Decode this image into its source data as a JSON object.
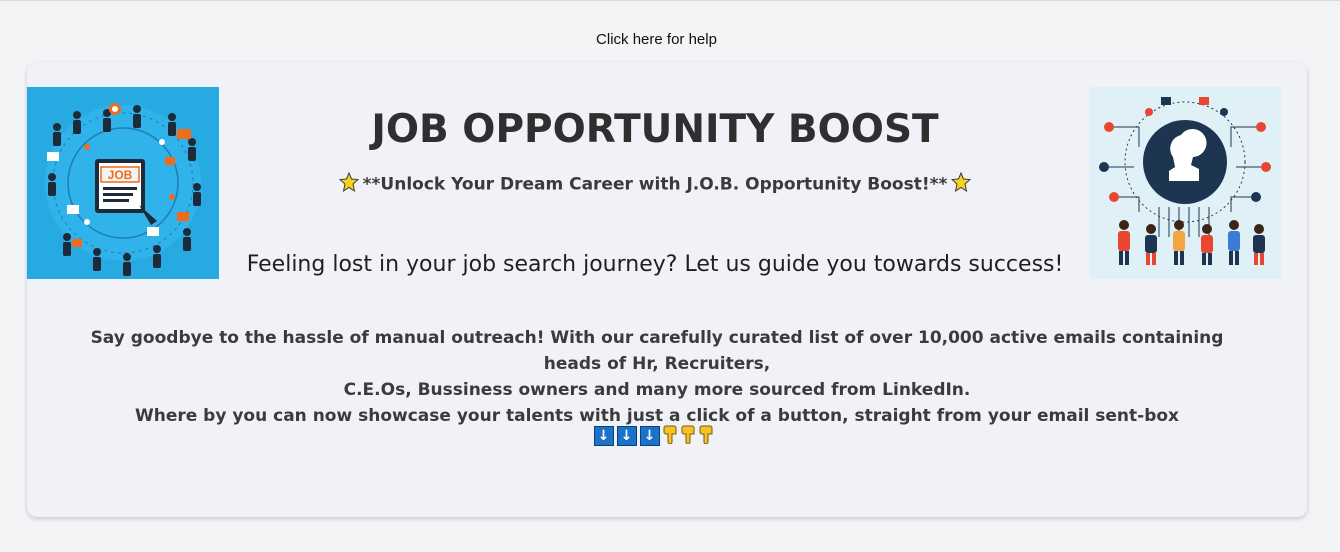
{
  "help_link": "Click here for help",
  "header": {
    "title": "JOB OPPORTUNITY BOOST",
    "subtitle": "**Unlock Your Dream Career with J.O.B. Opportunity Boost!**"
  },
  "tagline": "Feeling lost in your job search journey? Let us guide you towards success!",
  "body": {
    "line1": "Say goodbye to the hassle of manual outreach! With our carefully curated list of over 10,000 active emails containing heads of Hr, Recruiters,",
    "line2": "C.E.Os, Bussiness owners and many more sourced from LinkedIn.",
    "line3": "Where by you can now showcase your talents with just a click of a button, straight from your email sent-box"
  },
  "images": {
    "left_badge": "JOB"
  },
  "icons": {
    "star": "sparkle-star-icon",
    "arrow": "down-arrow-icon",
    "hand": "pointing-down-hand-icon"
  },
  "arrow_glyph": "↓",
  "colors": {
    "background": "#f3f4f6",
    "card": "#f0f2f7",
    "arrow_blue": "#1a73c8",
    "job_orange": "#f26b1d",
    "left_img_bg": "#27a9e1",
    "right_img_bg": "#dff1f7"
  }
}
